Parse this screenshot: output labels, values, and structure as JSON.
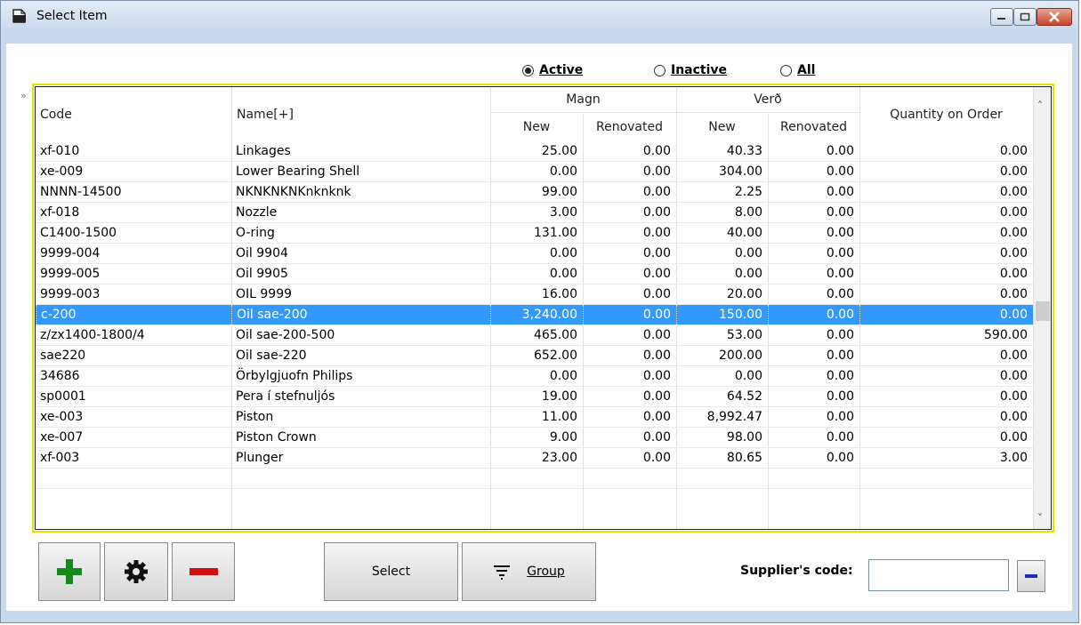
{
  "window": {
    "title": "Select Item",
    "controls": [
      "minimize",
      "maximize",
      "close"
    ]
  },
  "filter": {
    "options": [
      {
        "label": "Active",
        "selected": true
      },
      {
        "label": "Inactive",
        "selected": false
      },
      {
        "label": "All",
        "selected": false
      }
    ]
  },
  "grid": {
    "headers": {
      "code": "Code",
      "name": "Name[+]",
      "magn": "Magn",
      "magn_new": "New",
      "magn_renovated": "Renovated",
      "verd": "Verð",
      "verd_new": "New",
      "verd_renovated": "Renovated",
      "quantity_on_order": "Quantity on Order"
    },
    "selected_index": 8,
    "rows": [
      {
        "code": "xf-010",
        "name": "Linkages",
        "magn_new": "25.00",
        "magn_ren": "0.00",
        "verd_new": "40.33",
        "verd_ren": "0.00",
        "qoo": "0.00"
      },
      {
        "code": "xe-009",
        "name": "Lower Bearing Shell",
        "magn_new": "0.00",
        "magn_ren": "0.00",
        "verd_new": "304.00",
        "verd_ren": "0.00",
        "qoo": "0.00"
      },
      {
        "code": "NNNN-14500",
        "name": "NKNKNKNKnknknk",
        "magn_new": "99.00",
        "magn_ren": "0.00",
        "verd_new": "2.25",
        "verd_ren": "0.00",
        "qoo": "0.00"
      },
      {
        "code": "xf-018",
        "name": "Nozzle",
        "magn_new": "3.00",
        "magn_ren": "0.00",
        "verd_new": "8.00",
        "verd_ren": "0.00",
        "qoo": "0.00"
      },
      {
        "code": "C1400-1500",
        "name": "O-ring",
        "magn_new": "131.00",
        "magn_ren": "0.00",
        "verd_new": "40.00",
        "verd_ren": "0.00",
        "qoo": "0.00"
      },
      {
        "code": "9999-004",
        "name": "Oil 9904",
        "magn_new": "0.00",
        "magn_ren": "0.00",
        "verd_new": "0.00",
        "verd_ren": "0.00",
        "qoo": "0.00"
      },
      {
        "code": "9999-005",
        "name": "Oil 9905",
        "magn_new": "0.00",
        "magn_ren": "0.00",
        "verd_new": "0.00",
        "verd_ren": "0.00",
        "qoo": "0.00"
      },
      {
        "code": "9999-003",
        "name": "OIL 9999",
        "magn_new": "16.00",
        "magn_ren": "0.00",
        "verd_new": "20.00",
        "verd_ren": "0.00",
        "qoo": "0.00"
      },
      {
        "code": "c-200",
        "name": "Oil sae-200",
        "magn_new": "3,240.00",
        "magn_ren": "0.00",
        "verd_new": "150.00",
        "verd_ren": "0.00",
        "qoo": "0.00"
      },
      {
        "code": "z/zx1400-1800/4",
        "name": "Oil sae-200-500",
        "magn_new": "465.00",
        "magn_ren": "0.00",
        "verd_new": "53.00",
        "verd_ren": "0.00",
        "qoo": "590.00"
      },
      {
        "code": "sae220",
        "name": "Oil sae-220",
        "magn_new": "652.00",
        "magn_ren": "0.00",
        "verd_new": "200.00",
        "verd_ren": "0.00",
        "qoo": "0.00"
      },
      {
        "code": "34686",
        "name": "Örbylgjuofn Philips",
        "magn_new": "0.00",
        "magn_ren": "0.00",
        "verd_new": "0.00",
        "verd_ren": "0.00",
        "qoo": "0.00"
      },
      {
        "code": "sp0001",
        "name": "Pera í stefnuljós",
        "magn_new": "19.00",
        "magn_ren": "0.00",
        "verd_new": "64.52",
        "verd_ren": "0.00",
        "qoo": "0.00"
      },
      {
        "code": "xe-003",
        "name": "Piston",
        "magn_new": "11.00",
        "magn_ren": "0.00",
        "verd_new": "8,992.47",
        "verd_ren": "0.00",
        "qoo": "0.00"
      },
      {
        "code": "xe-007",
        "name": "Piston Crown",
        "magn_new": "9.00",
        "magn_ren": "0.00",
        "verd_new": "98.00",
        "verd_ren": "0.00",
        "qoo": "0.00"
      },
      {
        "code": "xf-003",
        "name": "Plunger",
        "magn_new": "23.00",
        "magn_ren": "0.00",
        "verd_new": "80.65",
        "verd_ren": "0.00",
        "qoo": "3.00"
      }
    ]
  },
  "toolbar": {
    "add_icon": "plus-icon",
    "settings_icon": "gear-icon",
    "remove_icon": "minus-icon",
    "select_label": "Select",
    "group_label": "Group",
    "group_icon": "filter-icon"
  },
  "supplier": {
    "label": "Supplier's code:",
    "value": ""
  },
  "colors": {
    "selection": "#3399ff",
    "add_green": "#138a1b",
    "remove_red": "#d01010",
    "grid_border": "#e7e100",
    "close_red": "#c5452b"
  }
}
